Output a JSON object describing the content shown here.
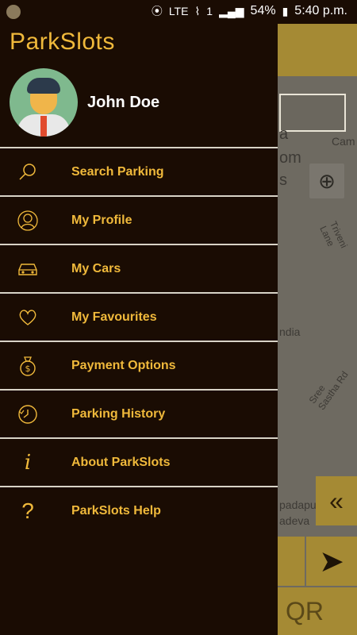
{
  "status_bar": {
    "battery": "54%",
    "time": "5:40 p.m.",
    "network": "LTE",
    "sim_slot": "1"
  },
  "app": {
    "title": "ParkSlots"
  },
  "user": {
    "name": "John Doe"
  },
  "menu": [
    {
      "label": "Search Parking",
      "icon": "search-icon"
    },
    {
      "label": "My Profile",
      "icon": "profile-icon"
    },
    {
      "label": "My Cars",
      "icon": "car-icon"
    },
    {
      "label": "My Favourites",
      "icon": "heart-icon"
    },
    {
      "label": "Payment Options",
      "icon": "money-bag-icon"
    },
    {
      "label": "Parking History",
      "icon": "clock-history-icon"
    },
    {
      "label": "About ParkSlots",
      "icon": "info-icon"
    },
    {
      "label": "ParkSlots Help",
      "icon": "help-icon"
    }
  ],
  "map": {
    "labels": [
      "Cam",
      "a",
      "om",
      "s",
      "Triveni Lane",
      "ndia",
      "Sree Sastha Rd",
      "padapu",
      "adeva",
      "QR"
    ]
  },
  "colors": {
    "accent": "#f0b93b",
    "drawer_bg": "#1a0c03",
    "map_button": "#a58a34"
  }
}
